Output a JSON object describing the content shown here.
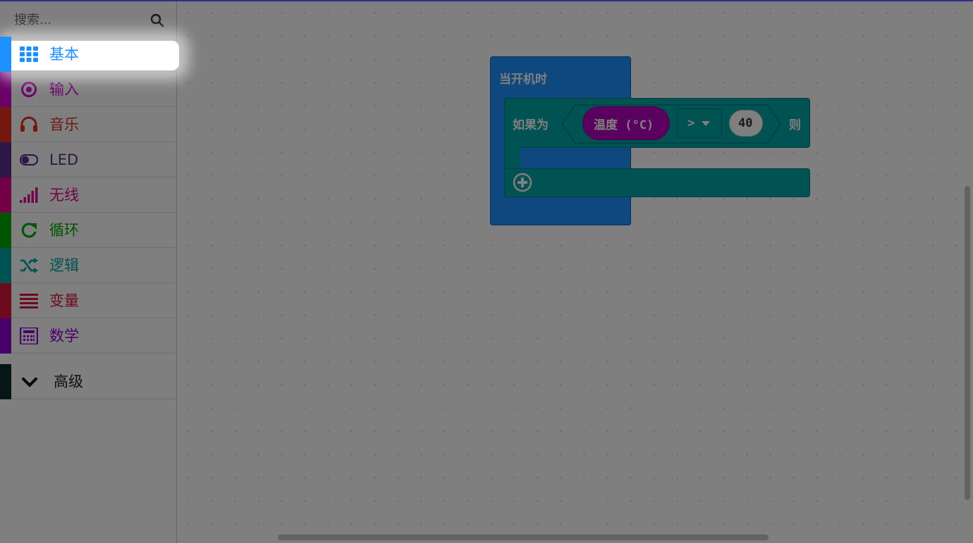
{
  "search": {
    "placeholder": "搜索..."
  },
  "toolbox": {
    "categories": [
      {
        "label": "基本",
        "color": "#1e90ff",
        "icon": "grid-icon"
      },
      {
        "label": "输入",
        "color": "#d400d4",
        "icon": "target-icon"
      },
      {
        "label": "音乐",
        "color": "#e63022",
        "icon": "headphones-icon"
      },
      {
        "label": "LED",
        "color": "#5c2d91",
        "icon": "toggle-icon"
      },
      {
        "label": "无线",
        "color": "#e3008c",
        "icon": "signal-bars-icon"
      },
      {
        "label": "循环",
        "color": "#00aa00",
        "icon": "refresh-icon"
      },
      {
        "label": "逻辑",
        "color": "#00a4a6",
        "icon": "shuffle-icon"
      },
      {
        "label": "变量",
        "color": "#dc143c",
        "icon": "lines-icon"
      },
      {
        "label": "数学",
        "color": "#9400d3",
        "icon": "calculator-icon"
      }
    ],
    "advanced": {
      "label": "高级",
      "color": "#0c2a2a",
      "icon": "chevron-down-icon"
    }
  },
  "workspace": {
    "on_start": {
      "label": "当开机时",
      "color": "#1e90ff"
    },
    "if_block": {
      "if_label": "如果为",
      "then_label": "则",
      "color": "#00a4a6",
      "sensor": {
        "label": "温度 (°C)",
        "color": "#b400bf"
      },
      "operator": {
        "label": ">"
      },
      "value": {
        "label": "40"
      }
    }
  }
}
